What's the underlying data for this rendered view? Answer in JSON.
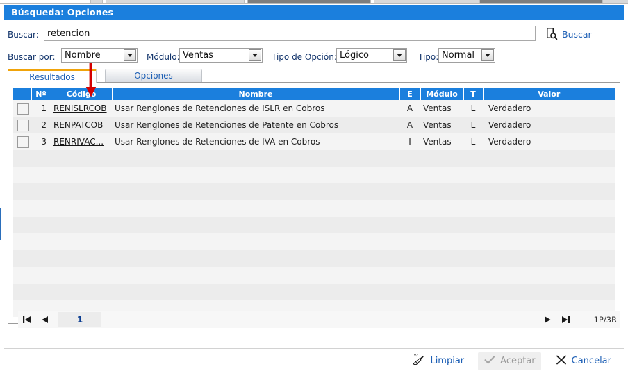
{
  "window": {
    "title": "Búsqueda: Opciones",
    "title_bg": "#1b7fdd"
  },
  "search": {
    "label": "Buscar:",
    "value": "retencion",
    "placeholder": "",
    "button_label": "Buscar",
    "button_icon": "document-search-icon"
  },
  "filters": {
    "buscar_por": {
      "label": "Buscar por:",
      "value": "Nombre"
    },
    "modulo": {
      "label": "Módulo:",
      "value": "Ventas"
    },
    "tipo_opcion": {
      "label": "Tipo de Opción:",
      "value": "Lógico"
    },
    "tipo": {
      "label": "Tipo:",
      "value": "Normal"
    }
  },
  "tabs": [
    {
      "label": "Resultados",
      "active": true
    },
    {
      "label": "Opciones",
      "active": false
    }
  ],
  "grid": {
    "columns": [
      {
        "key": "check",
        "label": ""
      },
      {
        "key": "num",
        "label": "Nº"
      },
      {
        "key": "codigo",
        "label": "Código"
      },
      {
        "key": "nombre",
        "label": "Nombre"
      },
      {
        "key": "e",
        "label": "E"
      },
      {
        "key": "modulo",
        "label": "Módulo"
      },
      {
        "key": "t",
        "label": "T"
      },
      {
        "key": "valor",
        "label": "Valor"
      }
    ],
    "rows": [
      {
        "num": "1",
        "codigo": "RENISLRCOB",
        "nombre": "Usar Renglones de Retenciones de ISLR en Cobros",
        "e": "A",
        "modulo": "Ventas",
        "t": "L",
        "valor": "Verdadero"
      },
      {
        "num": "2",
        "codigo": "RENPATCOB",
        "nombre": "Usar Renglones de Retenciones de Patente en Cobros",
        "e": "A",
        "modulo": "Ventas",
        "t": "L",
        "valor": "Verdadero"
      },
      {
        "num": "3",
        "codigo": "RENRIVAC...",
        "nombre": "Usar Renglones de Retenciones de IVA en Cobros",
        "e": "I",
        "modulo": "Ventas",
        "t": "L",
        "valor": "Verdadero"
      }
    ]
  },
  "pager": {
    "first_icon": "first-page-icon",
    "prev_icon": "previous-page-icon",
    "next_icon": "next-page-icon",
    "last_icon": "last-page-icon",
    "current_page": "1",
    "summary": "1P/3R"
  },
  "footer": {
    "limpiar": {
      "label": "Limpiar",
      "icon": "broom-icon"
    },
    "aceptar": {
      "label": "Aceptar",
      "icon": "check-icon",
      "disabled": true
    },
    "cancelar": {
      "label": "Cancelar",
      "icon": "close-x-icon"
    }
  },
  "annotation": {
    "arrow_color": "#d40000",
    "points_at": "Código"
  }
}
